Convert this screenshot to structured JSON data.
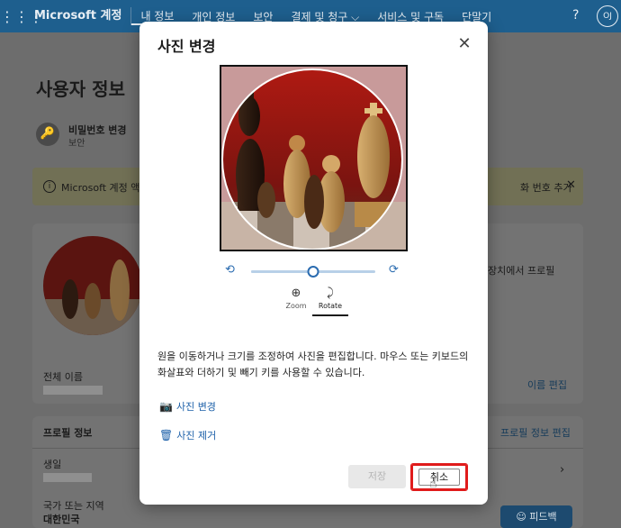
{
  "colors": {
    "topbar": "#1e5f8e",
    "accent": "#2b6cb0",
    "cancel_highlight": "#e01b1b",
    "dim_overlay": "#6d6d6d"
  },
  "topbar": {
    "waffle_icon": "waffle-icon",
    "brand": "Microsoft 계정",
    "nav": [
      "내 정보",
      "개인 정보",
      "보안",
      "결제 및 청구 ⌵",
      "서비스 및 구독",
      "단말기"
    ],
    "active_nav": "내 정보",
    "help": "?",
    "avatar_initials": "OJ"
  },
  "background": {
    "title": "사용자 정보",
    "password": {
      "label": "비밀번호 변경",
      "sub": "보안"
    },
    "notice": {
      "text": "Microsoft 계정 액",
      "right_text": "화 번호 추가"
    },
    "profile_side_text": "장치에서 프로필",
    "full_name_label": "전체 이름",
    "edit_name": "이름 편집",
    "profile_info": "프로필 정보",
    "profile_info_edit": "프로필 정보 편집",
    "birth_label": "생일",
    "country_label": "국가 또는 지역",
    "country_value": "대한민국",
    "feedback": "피드백"
  },
  "dialog": {
    "title": "사진 변경",
    "close_icon": "close-icon",
    "zoom_level": 0.5,
    "modes": [
      {
        "label": "Zoom",
        "icon": "zoom-icon"
      },
      {
        "label": "Rotate",
        "icon": "rotate-icon"
      }
    ],
    "selected_mode": "Rotate",
    "description": "원을 이동하거나 크기를 조정하여 사진을 편집합니다. 마우스 또는 키보드의 화살표와 더하기 및 빼기 키를 사용할 수 있습니다.",
    "change_photo": "사진 변경",
    "remove_photo": "사진 제거",
    "save": "저장",
    "cancel": "취소"
  }
}
